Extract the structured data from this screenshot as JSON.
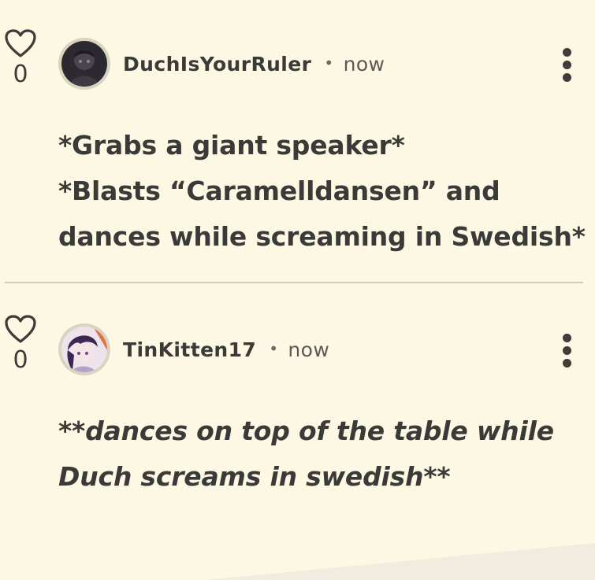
{
  "comments": [
    {
      "likes": "0",
      "username": "DuchIsYourRuler",
      "separator": "•",
      "time": "now",
      "body_lines": [
        "*Grabs a giant speaker*",
        "*Blasts “Caramelldansen” and",
        "dances while screaming in Swedish*"
      ]
    },
    {
      "likes": "0",
      "username": "TinKitten17",
      "separator": "•",
      "time": "now",
      "body_lines": [
        "**dances on top of the table while",
        "Duch screams in swedish**"
      ]
    }
  ],
  "icons": {
    "like": "heart-outline-icon",
    "menu": "more-vertical-icon"
  },
  "colors": {
    "background": "#fdf8e3",
    "text": "#3a3a38",
    "divider": "#cfcbbb"
  }
}
